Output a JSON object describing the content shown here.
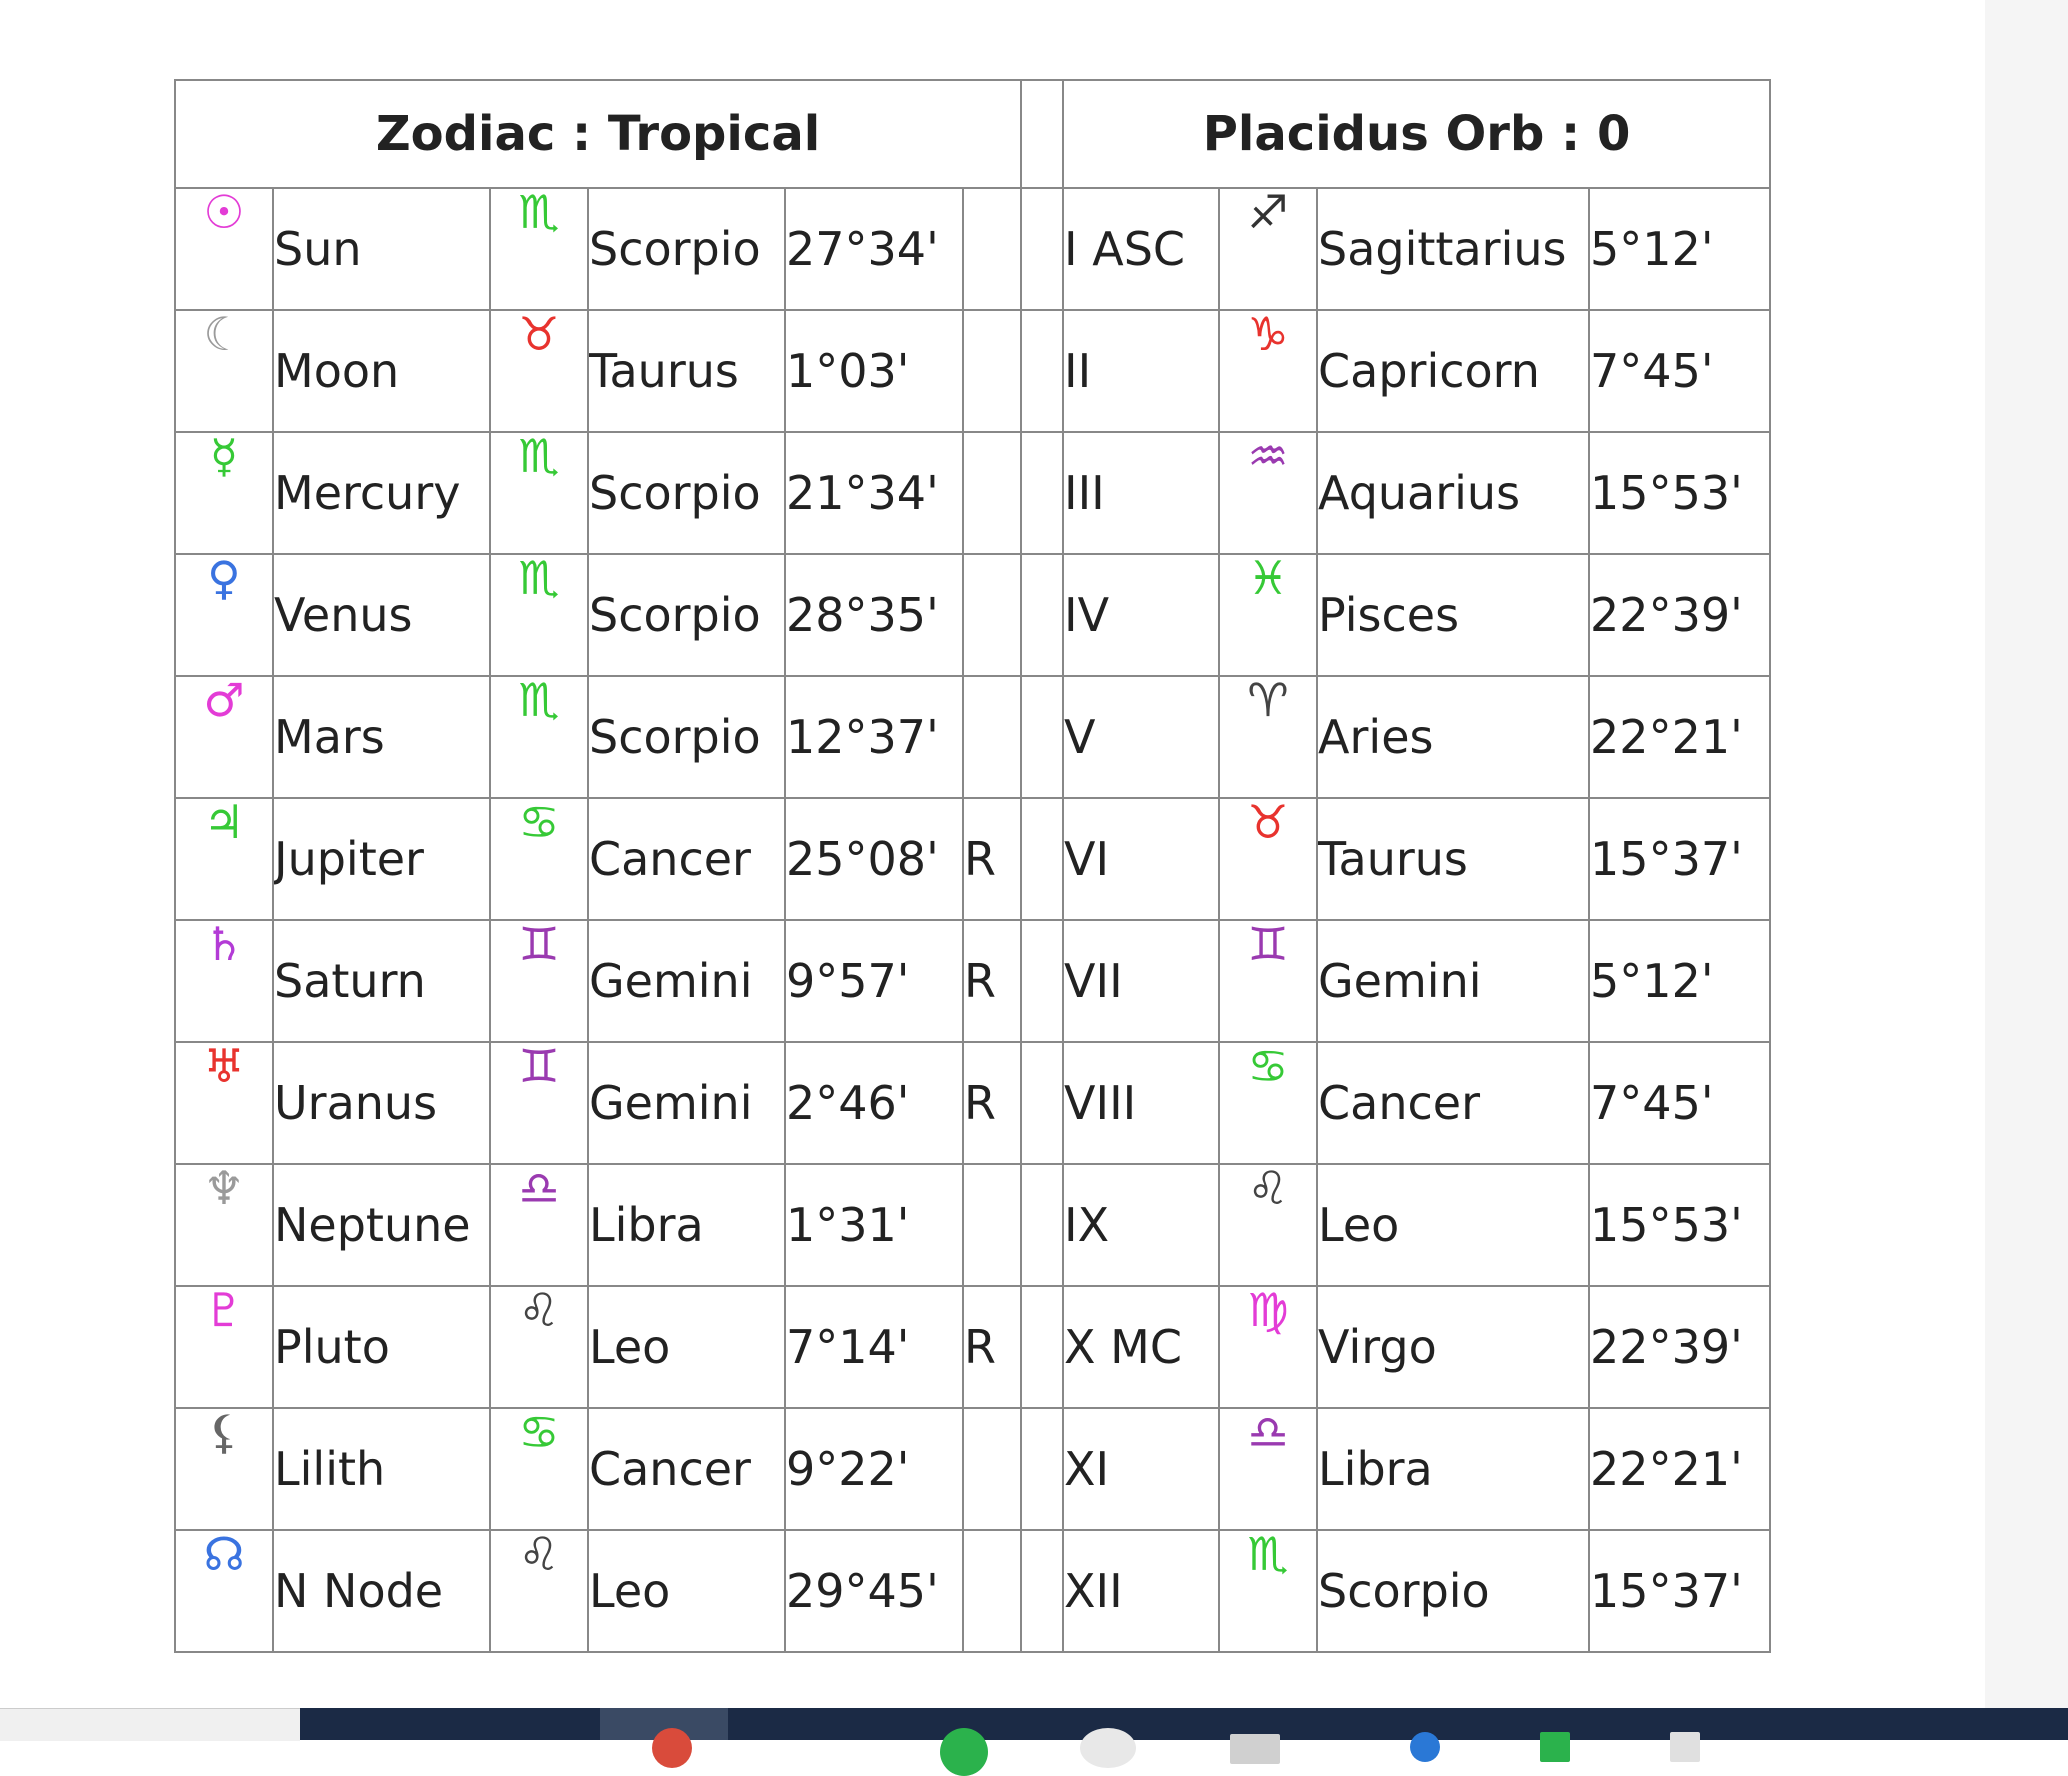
{
  "header": {
    "left_title": "Zodiac : Tropical",
    "right_title": "Placidus Orb : 0"
  },
  "colors": {
    "border": "#888888",
    "taskbar": "#1b2a45"
  },
  "planets": [
    {
      "glyph": "☉",
      "glyph_icon": "sun-icon",
      "glyph_color": "#e33cd6",
      "name": "Sun",
      "sign_glyph": "♏",
      "sign_icon": "scorpio-icon",
      "sign_color": "#36c936",
      "sign": "Scorpio",
      "degree": "27°34'",
      "retro": ""
    },
    {
      "glyph": "☾",
      "glyph_icon": "moon-icon",
      "glyph_color": "#9a9a9a",
      "name": "Moon",
      "sign_glyph": "♉",
      "sign_icon": "taurus-icon",
      "sign_color": "#e8332e",
      "sign": "Taurus",
      "degree": "1°03'",
      "retro": ""
    },
    {
      "glyph": "☿",
      "glyph_icon": "mercury-icon",
      "glyph_color": "#36c936",
      "name": "Mercury",
      "sign_glyph": "♏",
      "sign_icon": "scorpio-icon",
      "sign_color": "#36c936",
      "sign": "Scorpio",
      "degree": "21°34'",
      "retro": ""
    },
    {
      "glyph": "♀",
      "glyph_icon": "venus-icon",
      "glyph_color": "#3a73e0",
      "name": "Venus",
      "sign_glyph": "♏",
      "sign_icon": "scorpio-icon",
      "sign_color": "#36c936",
      "sign": "Scorpio",
      "degree": "28°35'",
      "retro": ""
    },
    {
      "glyph": "♂",
      "glyph_icon": "mars-icon",
      "glyph_color": "#e33cd6",
      "name": "Mars",
      "sign_glyph": "♏",
      "sign_icon": "scorpio-icon",
      "sign_color": "#36c936",
      "sign": "Scorpio",
      "degree": "12°37'",
      "retro": ""
    },
    {
      "glyph": "♃",
      "glyph_icon": "jupiter-icon",
      "glyph_color": "#36c936",
      "name": "Jupiter",
      "sign_glyph": "♋",
      "sign_icon": "cancer-icon",
      "sign_color": "#36c936",
      "sign": "Cancer",
      "degree": "25°08'",
      "retro": "R"
    },
    {
      "glyph": "♄",
      "glyph_icon": "saturn-icon",
      "glyph_color": "#b33bd6",
      "name": "Saturn",
      "sign_glyph": "♊",
      "sign_icon": "gemini-icon",
      "sign_color": "#9a3ab0",
      "sign": "Gemini",
      "degree": "9°57'",
      "retro": "R"
    },
    {
      "glyph": "♅",
      "glyph_icon": "uranus-icon",
      "glyph_color": "#e8332e",
      "name": "Uranus",
      "sign_glyph": "♊",
      "sign_icon": "gemini-icon",
      "sign_color": "#9a3ab0",
      "sign": "Gemini",
      "degree": "2°46'",
      "retro": "R"
    },
    {
      "glyph": "♆",
      "glyph_icon": "neptune-icon",
      "glyph_color": "#9a9a9a",
      "name": "Neptune",
      "sign_glyph": "♎",
      "sign_icon": "libra-icon",
      "sign_color": "#9a3ab0",
      "sign": "Libra",
      "degree": "1°31'",
      "retro": ""
    },
    {
      "glyph": "♇",
      "glyph_icon": "pluto-icon",
      "glyph_color": "#e33cd6",
      "name": "Pluto",
      "sign_glyph": "♌",
      "sign_icon": "leo-icon",
      "sign_color": "#444444",
      "sign": "Leo",
      "degree": "7°14'",
      "retro": "R"
    },
    {
      "glyph": "⚸",
      "glyph_icon": "lilith-icon",
      "glyph_color": "#666666",
      "name": "Lilith",
      "sign_glyph": "♋",
      "sign_icon": "cancer-icon",
      "sign_color": "#36c936",
      "sign": "Cancer",
      "degree": "9°22'",
      "retro": ""
    },
    {
      "glyph": "☊",
      "glyph_icon": "north-node-icon",
      "glyph_color": "#3a73e0",
      "name": "N Node",
      "sign_glyph": "♌",
      "sign_icon": "leo-icon",
      "sign_color": "#444444",
      "sign": "Leo",
      "degree": "29°45'",
      "retro": ""
    }
  ],
  "houses": [
    {
      "house": "I ASC",
      "sign_glyph": "♐",
      "sign_icon": "sagittarius-icon",
      "sign_color": "#333333",
      "sign": "Sagittarius",
      "degree": "5°12'"
    },
    {
      "house": "II",
      "sign_glyph": "♑",
      "sign_icon": "capricorn-icon",
      "sign_color": "#e8332e",
      "sign": "Capricorn",
      "degree": "7°45'"
    },
    {
      "house": "III",
      "sign_glyph": "♒",
      "sign_icon": "aquarius-icon",
      "sign_color": "#9a3ab0",
      "sign": "Aquarius",
      "degree": "15°53'"
    },
    {
      "house": "IV",
      "sign_glyph": "♓",
      "sign_icon": "pisces-icon",
      "sign_color": "#36c936",
      "sign": "Pisces",
      "degree": "22°39'"
    },
    {
      "house": "V",
      "sign_glyph": "♈",
      "sign_icon": "aries-icon",
      "sign_color": "#444444",
      "sign": "Aries",
      "degree": "22°21'"
    },
    {
      "house": "VI",
      "sign_glyph": "♉",
      "sign_icon": "taurus-icon",
      "sign_color": "#e8332e",
      "sign": "Taurus",
      "degree": "15°37'"
    },
    {
      "house": "VII",
      "sign_glyph": "♊",
      "sign_icon": "gemini-icon",
      "sign_color": "#9a3ab0",
      "sign": "Gemini",
      "degree": "5°12'"
    },
    {
      "house": "VIII",
      "sign_glyph": "♋",
      "sign_icon": "cancer-icon",
      "sign_color": "#36c936",
      "sign": "Cancer",
      "degree": "7°45'"
    },
    {
      "house": "IX",
      "sign_glyph": "♌",
      "sign_icon": "leo-icon",
      "sign_color": "#444444",
      "sign": "Leo",
      "degree": "15°53'"
    },
    {
      "house": "X MC",
      "sign_glyph": "♍",
      "sign_icon": "virgo-icon",
      "sign_color": "#e33cd6",
      "sign": "Virgo",
      "degree": "22°39'"
    },
    {
      "house": "XI",
      "sign_glyph": "♎",
      "sign_icon": "libra-icon",
      "sign_color": "#9a3ab0",
      "sign": "Libra",
      "degree": "22°21'"
    },
    {
      "house": "XII",
      "sign_glyph": "♏",
      "sign_icon": "scorpio-icon",
      "sign_color": "#36c936",
      "sign": "Scorpio",
      "degree": "15°37'"
    }
  ]
}
